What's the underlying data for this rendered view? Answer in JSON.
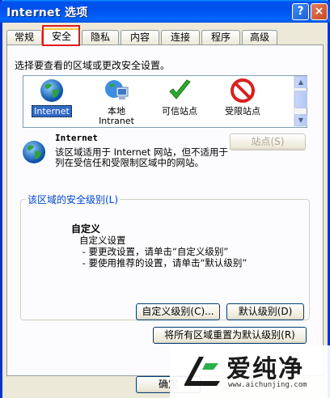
{
  "window": {
    "title": "Internet 选项"
  },
  "titlebar": {
    "help_label": "?",
    "close_label": "×"
  },
  "tabs": [
    {
      "label": "常规"
    },
    {
      "label": "安全"
    },
    {
      "label": "隐私"
    },
    {
      "label": "内容"
    },
    {
      "label": "连接"
    },
    {
      "label": "程序"
    },
    {
      "label": "高级"
    }
  ],
  "security": {
    "prompt": "选择要查看的区域或更改安全设置。",
    "zones": [
      {
        "label": "Internet",
        "sub": ""
      },
      {
        "label": "本地",
        "sub": "Intranet"
      },
      {
        "label": "可信站点",
        "sub": ""
      },
      {
        "label": "受限站点",
        "sub": ""
      }
    ],
    "selected": {
      "title": "Internet",
      "description": "该区域适用于 Internet 网站，但不适用于列在受信任和受限制区域中的网站。"
    },
    "sites_button": "站点(S)",
    "level_group_label": "该区域的安全级别(L)",
    "level": {
      "title": "自定义",
      "body": "自定义设置\n - 要更改设置，请单击“自定义级别”\n - 要使用推荐的设置，请单击“默认级别”"
    },
    "custom_level_button": "自定义级别(C)...",
    "default_level_button": "默认级别(D)",
    "reset_all_button": "将所有区域重置为默认级别(R)"
  },
  "footer": {
    "ok_button": "确定"
  },
  "watermark": {
    "brand": "爱纯净",
    "url": "www.aichunjing.com"
  }
}
